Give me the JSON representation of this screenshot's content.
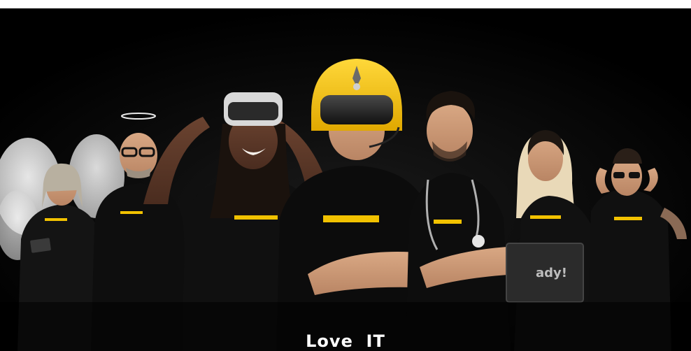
{
  "headline": "Love  IT",
  "laptop_text": "ady!",
  "colors": {
    "background": "#000000",
    "accent_stripe": "#f2c200",
    "helmet": "#f5c518",
    "text": "#ffffff"
  },
  "figures": [
    "angel-man",
    "halo-man",
    "vr-woman",
    "helmet-woman",
    "doctor-man",
    "laptop-woman",
    "sunglasses-man"
  ]
}
